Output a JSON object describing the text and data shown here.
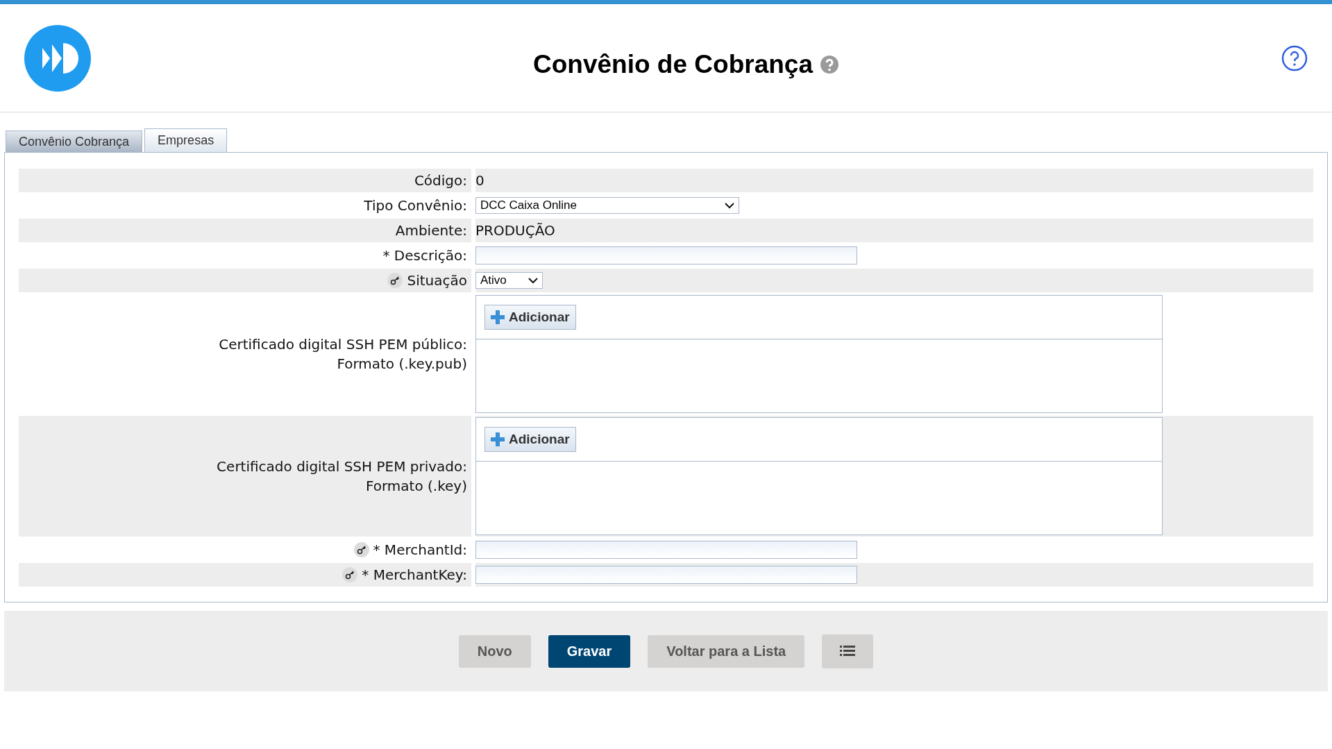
{
  "header": {
    "title": "Convênio de Cobrança"
  },
  "tabs": [
    {
      "label": "Convênio Cobrança",
      "selected": true
    },
    {
      "label": "Empresas",
      "selected": false
    }
  ],
  "fields": [
    {
      "kind": "text",
      "label": "Código:",
      "value": "0",
      "has_key": false
    },
    {
      "kind": "select",
      "label": "Tipo Convênio:",
      "value": "DCC Caixa Online",
      "has_key": false
    },
    {
      "kind": "text",
      "label": "Ambiente:",
      "value": "PRODUÇÃO",
      "has_key": false
    },
    {
      "kind": "input",
      "label": "* Descrição:",
      "has_key": false
    },
    {
      "kind": "short_select",
      "label": "Situação",
      "value": "Ativo",
      "has_key": true
    },
    {
      "kind": "upload",
      "label": "Certificado digital SSH PEM público:",
      "sublabel": "Formato (.key.pub)",
      "button": "Adicionar",
      "has_key": false
    },
    {
      "kind": "upload",
      "label": "Certificado digital SSH PEM privado:",
      "sublabel": "Formato (.key)",
      "button": "Adicionar",
      "has_key": false
    },
    {
      "kind": "input",
      "label": "* MerchantId:",
      "has_key": true
    },
    {
      "kind": "input",
      "label": "* MerchantKey:",
      "has_key": true
    }
  ],
  "actions": [
    {
      "label": "Novo",
      "kind": "secondary"
    },
    {
      "label": "Gravar",
      "kind": "primary"
    },
    {
      "label": "Voltar para a Lista",
      "kind": "secondary"
    },
    {
      "kind": "list"
    }
  ]
}
